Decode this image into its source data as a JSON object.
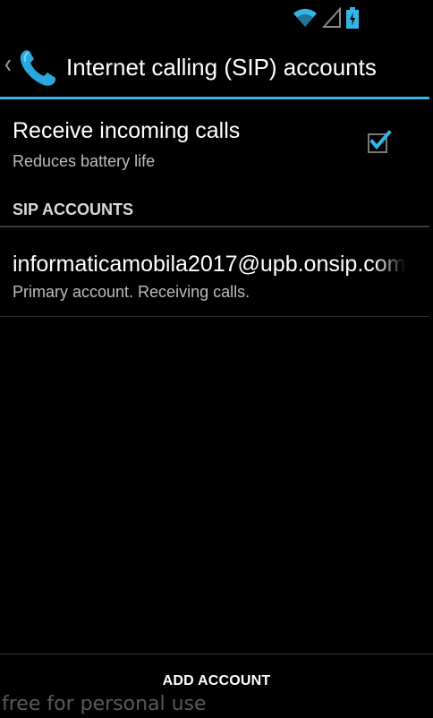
{
  "status_bar": {
    "icons": [
      "wifi-icon",
      "signal-icon",
      "battery-charging-icon"
    ],
    "accent_color": "#33b5e5"
  },
  "action_bar": {
    "title": "Internet calling (SIP) accounts",
    "up_icon": "chevron-left-icon",
    "app_icon": "phone-icon"
  },
  "receive_calls": {
    "title": "Receive incoming calls",
    "summary": "Reduces battery life",
    "checked": true
  },
  "sip_accounts": {
    "header": "SIP ACCOUNTS",
    "items": [
      {
        "name": "informaticamobila2017@upb.onsip.com",
        "summary": "Primary account. Receiving calls."
      }
    ]
  },
  "footer": {
    "add_account_label": "ADD ACCOUNT"
  },
  "watermark": "free for personal use"
}
